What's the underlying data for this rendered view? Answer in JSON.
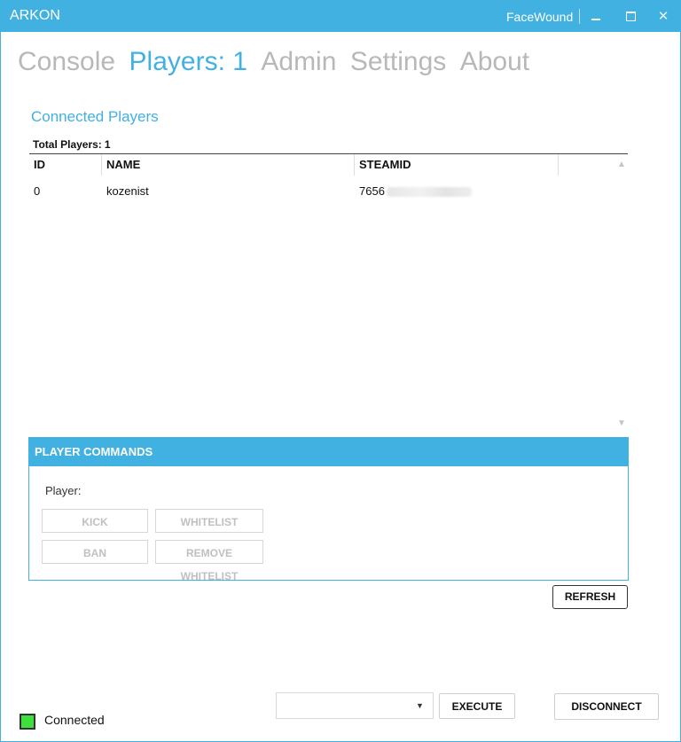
{
  "window": {
    "app_title": "ARKON",
    "user_name": "FaceWound",
    "controls": {
      "minimize_icon": "minimize-icon",
      "maximize_icon": "maximize-icon",
      "close_glyph": "✕"
    }
  },
  "nav": {
    "tabs": [
      {
        "label": "Console",
        "active": false
      },
      {
        "label": "Players: 1",
        "active": true
      },
      {
        "label": "Admin",
        "active": false
      },
      {
        "label": "Settings",
        "active": false
      },
      {
        "label": "About",
        "active": false
      }
    ]
  },
  "players": {
    "section_title": "Connected Players",
    "total_label": "Total Players:",
    "total_value": "1",
    "columns": [
      "ID",
      "NAME",
      "STEAMID"
    ],
    "rows": [
      {
        "id": "0",
        "name": "kozenist",
        "steamid_visible": "7656"
      }
    ],
    "scroll_up_glyph": "▲",
    "scroll_down_glyph": "▼"
  },
  "commands": {
    "header": "PLAYER COMMANDS",
    "player_label": "Player:",
    "kick_label": "KICK",
    "whitelist_label": "WHITELIST",
    "ban_label": "BAN",
    "remove_whitelist_label": "REMOVE WHITELIST"
  },
  "refresh_label": "REFRESH",
  "footer": {
    "status_text": "Connected",
    "status_color": "#3ee03e",
    "command_select_value": "",
    "dropdown_glyph": "▼",
    "execute_label": "EXECUTE",
    "disconnect_label": "DISCONNECT"
  },
  "colors": {
    "accent": "#41b1e1",
    "inactive_tab": "#b8b8b8"
  }
}
